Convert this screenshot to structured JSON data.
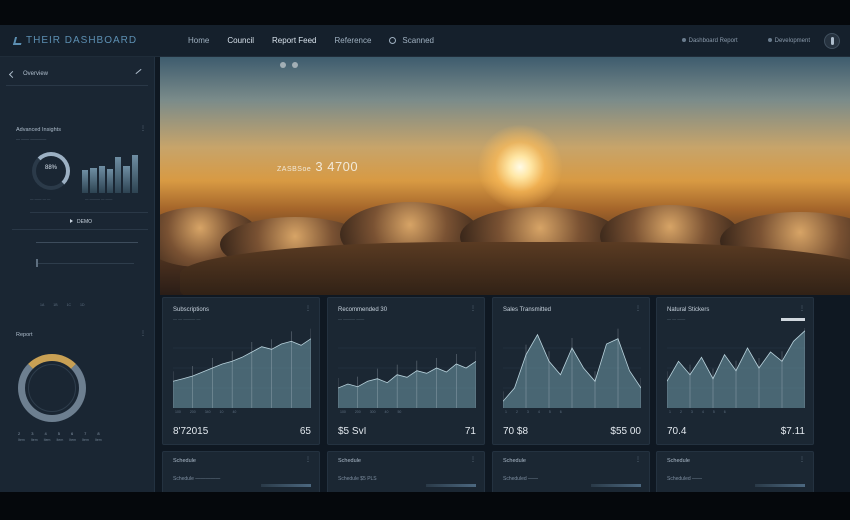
{
  "app": {
    "brand": "THEIR DASHBOARD",
    "nav": [
      {
        "label": "Home",
        "active": false
      },
      {
        "label": "Council",
        "active": true
      },
      {
        "label": "Report Feed",
        "active": true
      },
      {
        "label": "Reference",
        "active": false
      },
      {
        "label": "Scanned",
        "active": false
      }
    ],
    "top_right": [
      "Dashboard Report",
      "Development"
    ]
  },
  "sidebar": {
    "header": "Overview",
    "section1_title": "Advanced Insights",
    "section1_sub": "— —— ————",
    "gauge_value": "88%",
    "gauge_caption": "— —— — —",
    "bars_caption": "— ——— — ——",
    "action_label": "DEMO",
    "axis_ticks": [
      "1A",
      "1B",
      "1C",
      "1D"
    ],
    "section2_title": "Report",
    "donut_axis": [
      "2",
      "3",
      "4",
      "5",
      "6",
      "7",
      "8"
    ],
    "donut_axis2": [
      "Item",
      "Item",
      "Item",
      "Item",
      "Item",
      "Item",
      "Item"
    ]
  },
  "hero": {
    "headline": "ZASBSoe",
    "headline_value": "3 4700"
  },
  "cards": [
    {
      "title": "Subscriptions",
      "sub": "— — ——— —",
      "ticks": [
        "100",
        "200",
        "340",
        "10",
        "40"
      ],
      "value_left": "8'72015",
      "value_right": "65",
      "chart_data": {
        "type": "area",
        "values": [
          20,
          22,
          24,
          27,
          30,
          33,
          35,
          38,
          42,
          46,
          44,
          48,
          50,
          47,
          52
        ]
      }
    },
    {
      "title": "Recommended 30",
      "sub": "— ——— ——",
      "ticks": [
        "100",
        "200",
        "300",
        "40",
        "50"
      ],
      "value_left": "$5 SvI",
      "value_right": "71",
      "chart_data": {
        "type": "area",
        "values": [
          15,
          18,
          16,
          20,
          22,
          19,
          25,
          23,
          28,
          26,
          30,
          27,
          33,
          30,
          35
        ]
      }
    },
    {
      "title": "Sales Transmitted",
      "sub": "",
      "ticks": [
        "1",
        "2",
        "3",
        "4",
        "5",
        "6"
      ],
      "value_left": "70 $8",
      "value_right": "$55 00",
      "chart_data": {
        "type": "area",
        "values": [
          5,
          15,
          40,
          55,
          35,
          25,
          45,
          30,
          20,
          48,
          52,
          28,
          15
        ]
      }
    },
    {
      "title": "Natural Stickers",
      "sub": "— — ——",
      "ticks": [
        "1",
        "2",
        "3",
        "4",
        "5",
        "6"
      ],
      "value_left": "70.4",
      "value_right": "$7.11",
      "chart_data": {
        "type": "area",
        "values": [
          20,
          35,
          25,
          38,
          22,
          40,
          28,
          45,
          30,
          42,
          35,
          50,
          58
        ]
      }
    }
  ],
  "bottom_cards": [
    {
      "title": "Schedule",
      "sub": "Schedule —————"
    },
    {
      "title": "Schedule",
      "sub": "Schedule $5 PLS"
    },
    {
      "title": "Schedule",
      "sub": "Scheduled ——"
    },
    {
      "title": "Schedule",
      "sub": "Scheduled ——"
    }
  ],
  "colors": {
    "accent": "#5c8fb2",
    "chart_fill": "#6f9aa8",
    "sun": "#ffe7a5"
  }
}
